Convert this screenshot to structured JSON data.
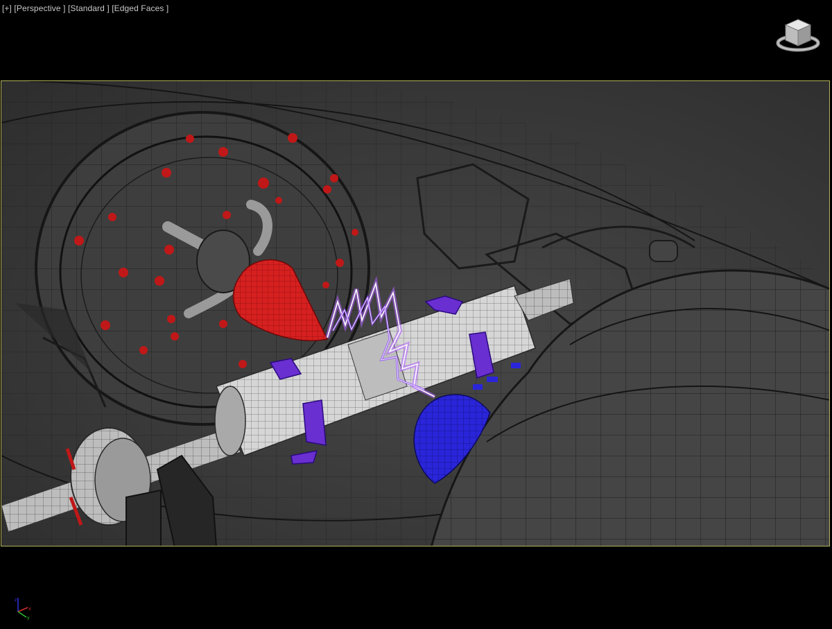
{
  "viewport": {
    "labels": [
      {
        "name": "viewport-menu-plus",
        "text": "[+]"
      },
      {
        "name": "viewport-menu-pov",
        "text": "[Perspective ]"
      },
      {
        "name": "viewport-menu-shading",
        "text": "[Standard ]"
      },
      {
        "name": "viewport-menu-display",
        "text": "[Edged Faces ]"
      }
    ],
    "frame_border_color": "#b3b35a",
    "background_color": "#000000",
    "scene_background_color": "#3a3a3a"
  },
  "scene": {
    "objects": [
      {
        "name": "outer-housing-wireframe",
        "color": "#1a1a1a"
      },
      {
        "name": "left-drum-wireframe",
        "color": "#1a1a1a"
      },
      {
        "name": "right-shell-wireframe",
        "color": "#1a1a1a"
      },
      {
        "name": "red-cone-emitter",
        "color": "#d62020"
      },
      {
        "name": "blue-sphere-receiver",
        "color": "#2a25d9"
      },
      {
        "name": "lightning-arc",
        "color": "#b060ff"
      },
      {
        "name": "central-rotor-cylinder",
        "color": "#c8c8c8"
      },
      {
        "name": "red-particles",
        "color": "#c01818"
      },
      {
        "name": "purple-fins",
        "color": "#6a2fd0"
      }
    ]
  },
  "icons": {
    "viewcube": "viewcube-icon",
    "axis": "axis-tripod-icon"
  },
  "axis_labels": {
    "x": "x",
    "y": "y",
    "z": "z"
  }
}
